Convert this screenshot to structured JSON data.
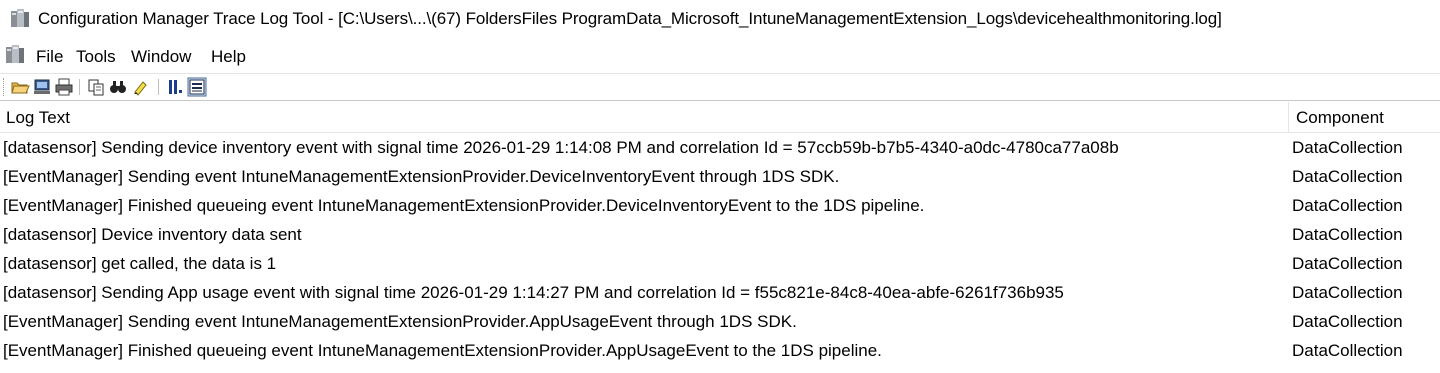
{
  "window": {
    "title": "Configuration Manager Trace Log Tool - [C:\\Users\\...\\(67) FoldersFiles ProgramData_Microsoft_IntuneManagementExtension_Logs\\devicehealthmonitoring.log]",
    "app_icon": "cmtrace-app-icon"
  },
  "menu": {
    "items": [
      "File",
      "Tools",
      "Window",
      "Help"
    ]
  },
  "toolbar": {
    "buttons": [
      {
        "icon": "open-folder-icon"
      },
      {
        "icon": "open-remote-icon"
      },
      {
        "icon": "print-icon"
      },
      {
        "icon": "copy-icon"
      },
      {
        "icon": "find-icon"
      },
      {
        "icon": "highlight-icon"
      },
      {
        "icon": "pause-icon"
      },
      {
        "icon": "show-details-icon"
      }
    ]
  },
  "columns": {
    "log_text": "Log Text",
    "component": "Component"
  },
  "log_rows": [
    {
      "text": "[datasensor] Sending device inventory event with signal time 2026-01-29 1:14:08 PM and correlation Id = 57ccb59b-b7b5-4340-a0dc-4780ca77a08b",
      "component": "DataCollection"
    },
    {
      "text": "[EventManager] Sending event IntuneManagementExtensionProvider.DeviceInventoryEvent through 1DS SDK.",
      "component": "DataCollection"
    },
    {
      "text": "[EventManager] Finished queueing event IntuneManagementExtensionProvider.DeviceInventoryEvent to the 1DS pipeline.",
      "component": "DataCollection"
    },
    {
      "text": "[datasensor] Device inventory data sent",
      "component": "DataCollection"
    },
    {
      "text": "[datasensor] get called, the data is 1",
      "component": "DataCollection"
    },
    {
      "text": "[datasensor] Sending App usage event with signal time 2026-01-29 1:14:27 PM and correlation Id = f55c821e-84c8-40ea-abfe-6261f736b935",
      "component": "DataCollection"
    },
    {
      "text": "[EventManager] Sending event IntuneManagementExtensionProvider.AppUsageEvent through 1DS SDK.",
      "component": "DataCollection"
    },
    {
      "text": "[EventManager] Finished queueing event IntuneManagementExtensionProvider.AppUsageEvent to the 1DS pipeline.",
      "component": "DataCollection"
    }
  ]
}
